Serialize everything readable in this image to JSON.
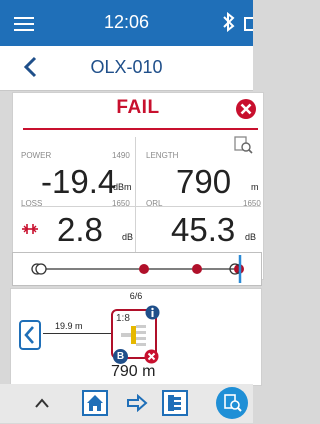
{
  "status": {
    "time": "12:06",
    "menu_icon": "hamburger-icon",
    "bt_icon": "bluetooth-icon"
  },
  "title": "OLX-010",
  "result": {
    "status": "FAIL"
  },
  "power": {
    "label": "POWER",
    "wavelength": "1490",
    "value": "-19.4",
    "unit": "dBm"
  },
  "length": {
    "label": "LENGTH",
    "value": "790",
    "unit": "m"
  },
  "loss": {
    "label": "LOSS",
    "wavelength": "1650",
    "value": "2.8",
    "unit": "dB"
  },
  "orl": {
    "label": "ORL",
    "wavelength": "1650",
    "value": "45.3",
    "unit": "dB"
  },
  "page": "6/6",
  "segment_length": "19.9 m",
  "element": {
    "ratio": "1:8",
    "badge": "B",
    "length": "790 m"
  },
  "colors": {
    "primary": "#1f6fb8",
    "fail": "#c8102e",
    "event": "#b0102a"
  }
}
